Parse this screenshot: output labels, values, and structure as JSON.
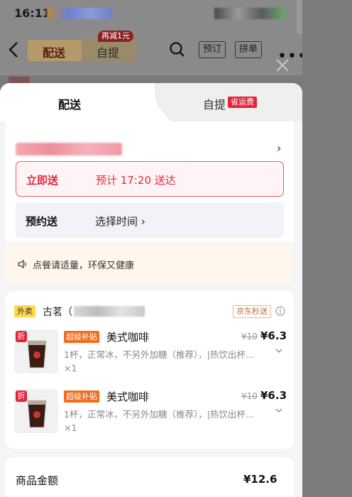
{
  "status_bar": {
    "time": "16:11"
  },
  "header": {
    "segments": [
      {
        "label": "配送"
      },
      {
        "label": "自提"
      }
    ],
    "promo_tag": "再减1元",
    "buttons": [
      {
        "label": "预订"
      },
      {
        "label": "拼单"
      }
    ],
    "more": "•••"
  },
  "sheet": {
    "tabs": [
      {
        "label": "配送"
      },
      {
        "label": "自提",
        "badge": "省运费"
      }
    ],
    "address_chevron": "›",
    "instant": {
      "label": "立即送",
      "eta": "预计 17:20 送达"
    },
    "schedule": {
      "label": "预约送",
      "pick": "选择时间 ›"
    },
    "tip": "点餐请适量，环保又健康",
    "shop": {
      "tag": "外卖",
      "name_prefix": "古茗（",
      "delivery_tag": "京东秒送"
    },
    "items": [
      {
        "discount_badge": "折",
        "tag": "超级补贴",
        "name": "美式咖啡",
        "orig_price": "¥10",
        "price": "¥6.3",
        "spec": "1杯，正常冰，不另外加糖（推荐），|热饮出杯...",
        "qty": "×1"
      },
      {
        "discount_badge": "折",
        "tag": "超级补贴",
        "name": "美式咖啡",
        "orig_price": "¥10",
        "price": "¥6.3",
        "spec": "1杯，正常冰，不另外加糖（推荐），|热饮出杯...",
        "qty": "×1"
      }
    ],
    "total": {
      "label": "商品金额",
      "value": "¥12.6"
    }
  },
  "colors": {
    "accent_red": "#e02b3f",
    "waimai_yellow": "#ffd84a",
    "subsidy_orange": "#f26b1d"
  }
}
